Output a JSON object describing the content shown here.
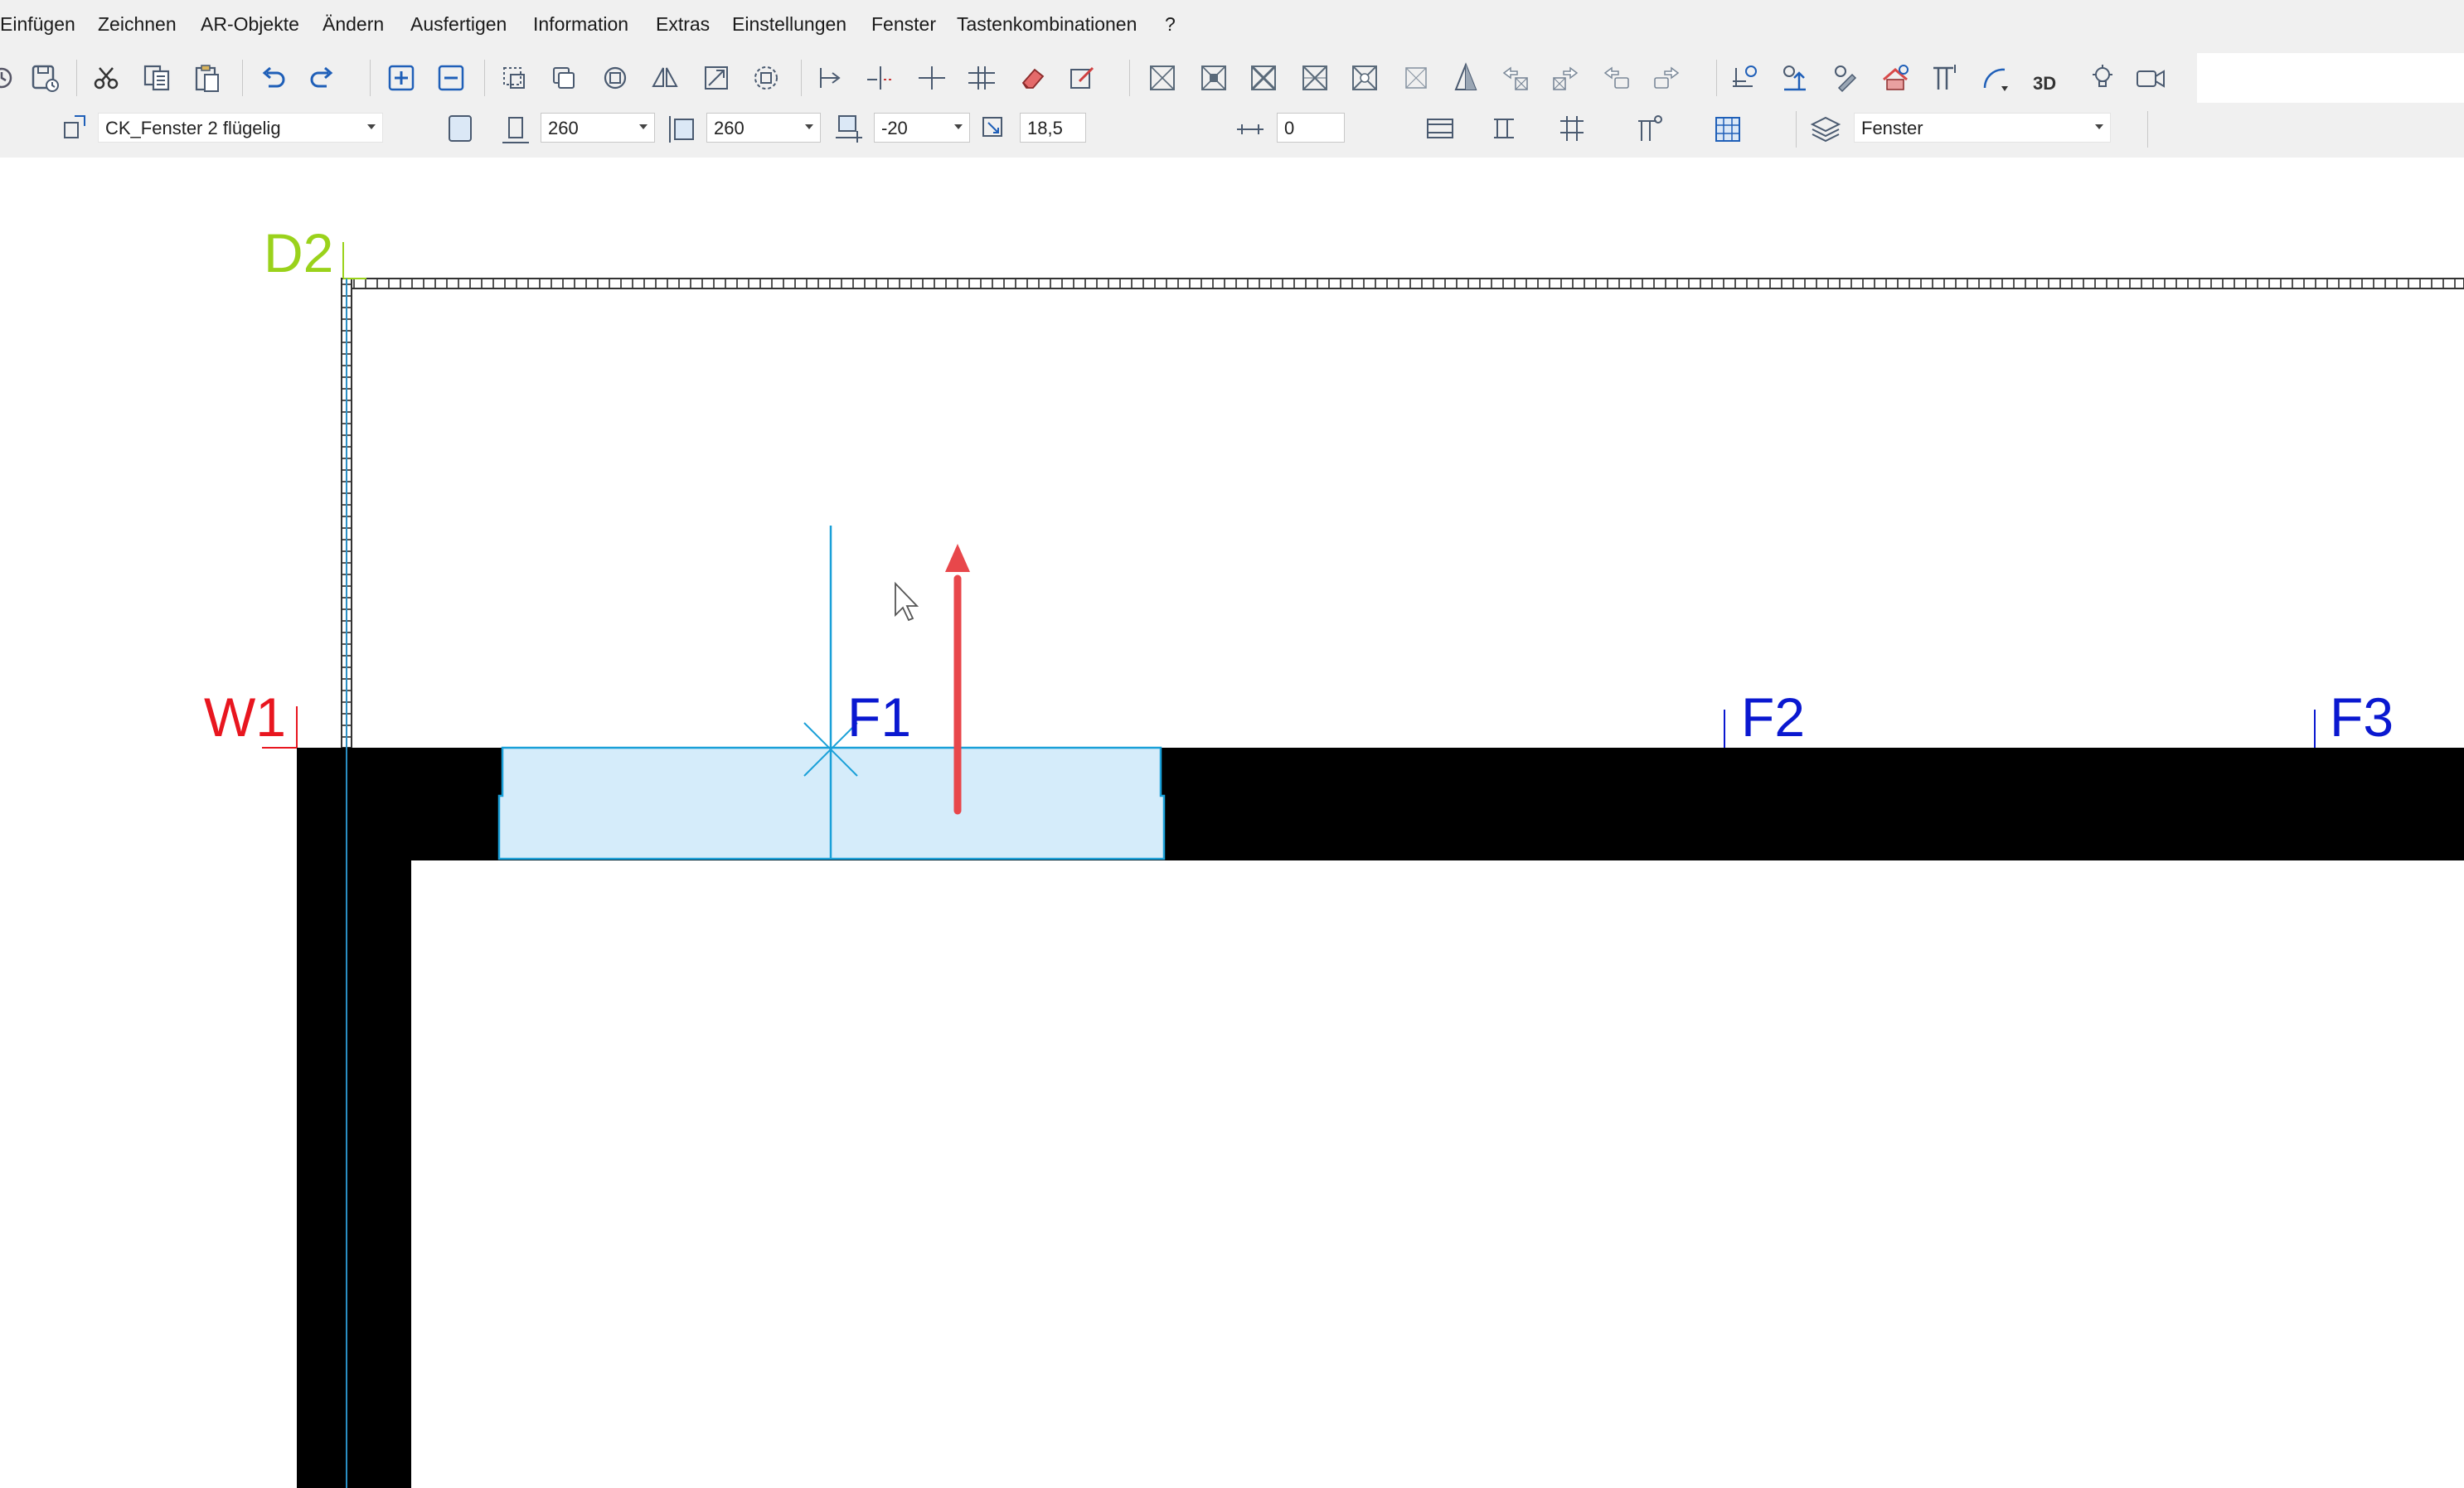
{
  "menu": {
    "items": [
      "Einfügen",
      "Zeichnen",
      "AR-Objekte",
      "Ändern",
      "Ausfertigen",
      "Information",
      "Extras",
      "Einstellungen",
      "Fenster",
      "Tastenkombinationen",
      "?"
    ]
  },
  "toolbar": {
    "icons": [
      "history-icon",
      "save-icon",
      "cut-icon",
      "copy-icon",
      "paste-icon",
      "undo-icon",
      "redo-icon",
      "zoom-in-icon",
      "zoom-out-icon",
      "select-icon",
      "duplicate-icon",
      "rotate-icon",
      "mirror-icon",
      "scale-icon",
      "transform-icon",
      "extend-icon",
      "trim-icon",
      "split-icon",
      "offset-icon",
      "eraser-icon",
      "edit-icon",
      "opening-1-icon",
      "opening-2-icon",
      "opening-3-icon",
      "opening-4-icon",
      "opening-5-icon",
      "opening-6-icon",
      "pyramid-icon",
      "arrow-left-icon",
      "arrow-right-icon",
      "move-left-icon",
      "move-right-icon",
      "layer-modify-icon",
      "level-icon",
      "brush-icon",
      "house-icon",
      "column-icon",
      "arc-icon",
      "3d-view-icon",
      "light-icon",
      "camera-icon"
    ],
    "label_3d": "3D"
  },
  "props": {
    "object_name": "CK_Fenster 2 flügelig",
    "width_value": "260",
    "height_value": "260",
    "sill_value": "-20",
    "depth_value": "18,5",
    "offset_value": "0",
    "layer_value": "Fenster"
  },
  "drawing": {
    "label_d2": "D2",
    "label_w1": "W1",
    "label_f1": "F1",
    "label_f2": "F2",
    "label_f3": "F3",
    "colors": {
      "d2": "#9ad21b",
      "w1": "#e8161f",
      "f_labels": "#0a18d0",
      "window": "#d5ecfa",
      "window_stroke": "#1aa0d8",
      "wall": "#000000",
      "arrow": "#e8474b"
    }
  }
}
